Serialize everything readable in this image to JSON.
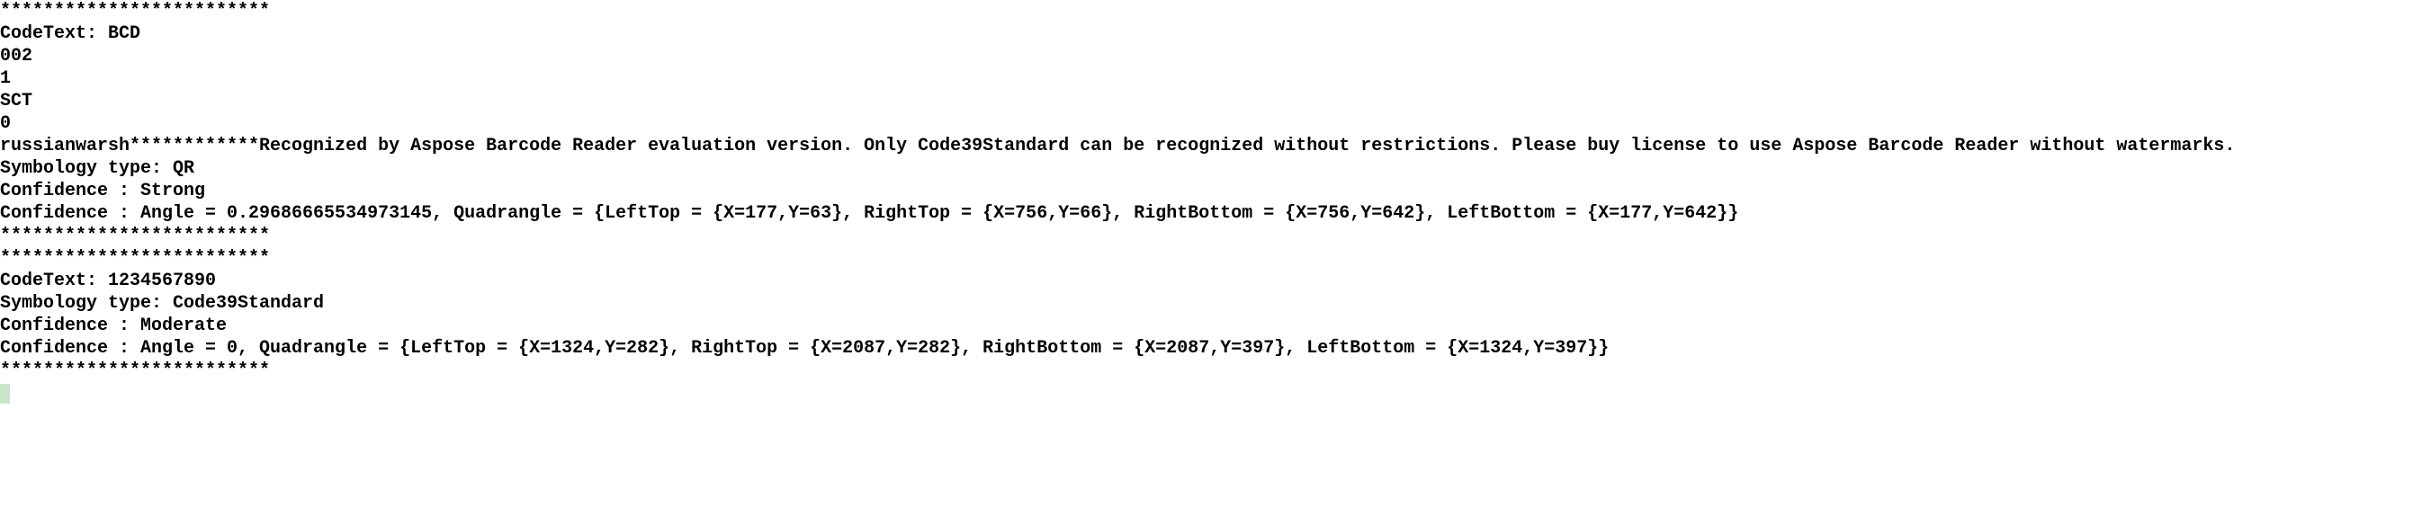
{
  "lines": [
    "*************************",
    "CodeText: BCD",
    "002",
    "1",
    "SCT",
    "0",
    "russianwarsh************Recognized by Aspose Barcode Reader evaluation version. Only Code39Standard can be recognized without restrictions. Please buy license to use Aspose Barcode Reader without watermarks.",
    "Symbology type: QR",
    "Confidence : Strong",
    "Confidence : Angle = 0.29686665534973145, Quadrangle = {LeftTop = {X=177,Y=63}, RightTop = {X=756,Y=66}, RightBottom = {X=756,Y=642}, LeftBottom = {X=177,Y=642}}",
    "*************************",
    "*************************",
    "CodeText: 1234567890",
    "Symbology type: Code39Standard",
    "Confidence : Moderate",
    "Confidence : Angle = 0, Quadrangle = {LeftTop = {X=1324,Y=282}, RightTop = {X=2087,Y=282}, RightBottom = {X=2087,Y=397}, LeftBottom = {X=1324,Y=397}}",
    "*************************"
  ]
}
